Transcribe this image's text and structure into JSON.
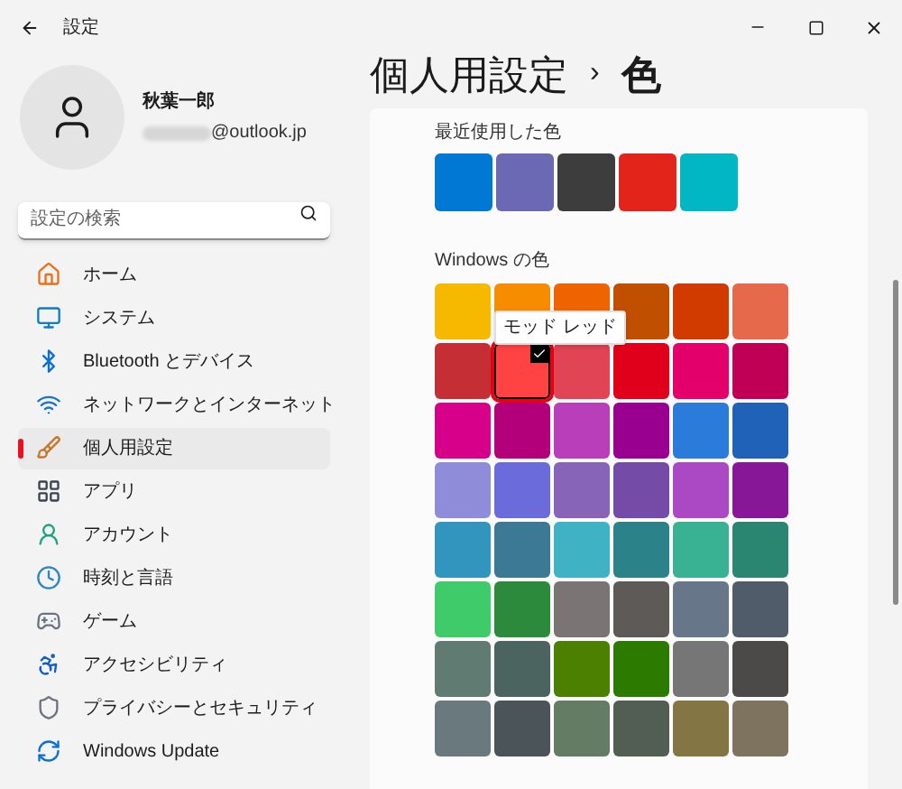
{
  "window": {
    "title": "設定"
  },
  "profile": {
    "name": "秋葉一郎",
    "email": "@outlook.jp"
  },
  "search": {
    "placeholder": "設定の検索"
  },
  "sidebar": {
    "items": [
      {
        "label": "ホーム",
        "selected": false
      },
      {
        "label": "システム",
        "selected": false
      },
      {
        "label": "Bluetooth とデバイス",
        "selected": false
      },
      {
        "label": "ネットワークとインターネット",
        "selected": false
      },
      {
        "label": "個人用設定",
        "selected": true
      },
      {
        "label": "アプリ",
        "selected": false
      },
      {
        "label": "アカウント",
        "selected": false
      },
      {
        "label": "時刻と言語",
        "selected": false
      },
      {
        "label": "ゲーム",
        "selected": false
      },
      {
        "label": "アクセシビリティ",
        "selected": false
      },
      {
        "label": "プライバシーとセキュリティ",
        "selected": false
      },
      {
        "label": "Windows Update",
        "selected": false
      }
    ]
  },
  "breadcrumb": {
    "parent": "個人用設定",
    "separator": "›",
    "current": "色"
  },
  "recent_colors": {
    "title": "最近使用した色",
    "swatches": [
      {
        "color": "#0078d4"
      },
      {
        "color": "#6b69b3"
      },
      {
        "color": "#3d3d3d"
      },
      {
        "color": "#e3241b"
      },
      {
        "color": "#00b7c3"
      }
    ]
  },
  "windows_colors": {
    "title": "Windows の色",
    "tooltip": "モッド レッド",
    "swatches": [
      {
        "color": "#f7b900",
        "selected": false
      },
      {
        "color": "#f78c00",
        "selected": false
      },
      {
        "color": "#f06400",
        "selected": false
      },
      {
        "color": "#c04f00",
        "selected": false
      },
      {
        "color": "#d13b00",
        "selected": false
      },
      {
        "color": "#e6694c",
        "selected": false
      },
      {
        "color": "#c42e34",
        "selected": false
      },
      {
        "color": "#ff4343",
        "selected": true
      },
      {
        "color": "#e04455",
        "selected": false
      },
      {
        "color": "#e0001b",
        "selected": false
      },
      {
        "color": "#e3006b",
        "selected": false
      },
      {
        "color": "#bf0055",
        "selected": false
      },
      {
        "color": "#d6008a",
        "selected": false
      },
      {
        "color": "#b3007a",
        "selected": false
      },
      {
        "color": "#b83fb9",
        "selected": false
      },
      {
        "color": "#990090",
        "selected": false
      },
      {
        "color": "#2b7bda",
        "selected": false
      },
      {
        "color": "#2162b9",
        "selected": false
      },
      {
        "color": "#8f8cda",
        "selected": false
      },
      {
        "color": "#6b6bdb",
        "selected": false
      },
      {
        "color": "#8764b8",
        "selected": false
      },
      {
        "color": "#744ca8",
        "selected": false
      },
      {
        "color": "#ab48c3",
        "selected": false
      },
      {
        "color": "#881798",
        "selected": false
      },
      {
        "color": "#3295bd",
        "selected": false
      },
      {
        "color": "#3b7995",
        "selected": false
      },
      {
        "color": "#3fb3c3",
        "selected": false
      },
      {
        "color": "#2c8289",
        "selected": false
      },
      {
        "color": "#38b293",
        "selected": false
      },
      {
        "color": "#2a8571",
        "selected": false
      },
      {
        "color": "#3fcb6a",
        "selected": false
      },
      {
        "color": "#2c8a3c",
        "selected": false
      },
      {
        "color": "#7a7574",
        "selected": false
      },
      {
        "color": "#5d5a58",
        "selected": false
      },
      {
        "color": "#68768a",
        "selected": false
      },
      {
        "color": "#515c6b",
        "selected": false
      },
      {
        "color": "#5f7b72",
        "selected": false
      },
      {
        "color": "#4b6460",
        "selected": false
      },
      {
        "color": "#4c8000",
        "selected": false
      },
      {
        "color": "#2c7b00",
        "selected": false
      },
      {
        "color": "#767676",
        "selected": false
      },
      {
        "color": "#4c4a48",
        "selected": false
      },
      {
        "color": "#69797e",
        "selected": false
      },
      {
        "color": "#4a5459",
        "selected": false
      },
      {
        "color": "#647c64",
        "selected": false
      },
      {
        "color": "#525e54",
        "selected": false
      },
      {
        "color": "#847545",
        "selected": false
      },
      {
        "color": "#7e735f",
        "selected": false
      }
    ]
  }
}
